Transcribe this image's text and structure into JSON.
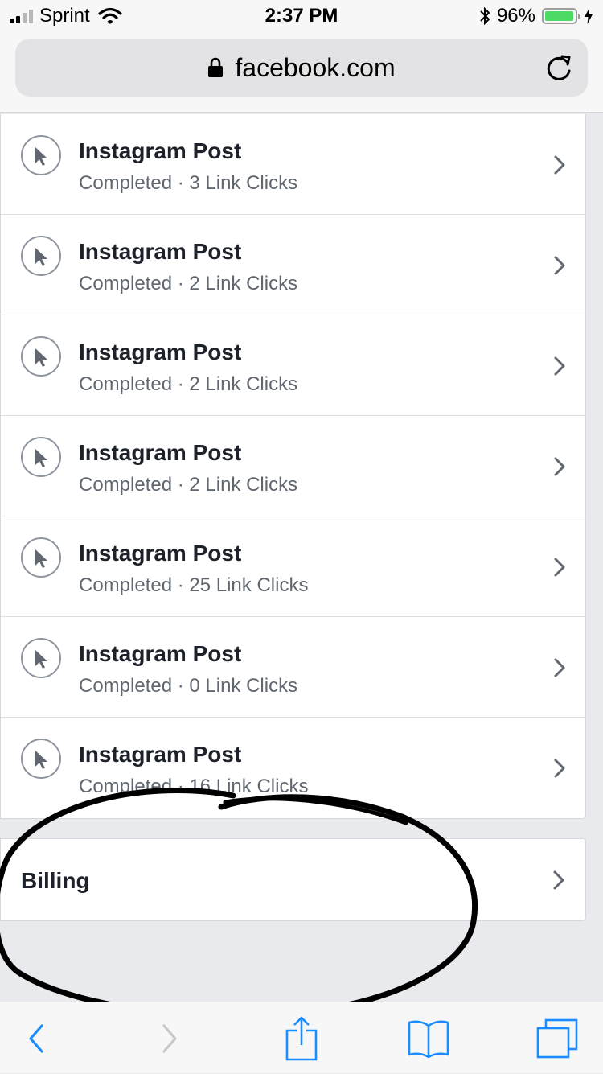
{
  "status_bar": {
    "carrier": "Sprint",
    "time": "2:37 PM",
    "battery_percent": "96%",
    "battery_level": 0.96,
    "icons": [
      "signal-icon",
      "wifi-icon",
      "bluetooth-icon",
      "battery-icon",
      "charging-icon"
    ]
  },
  "address_bar": {
    "url": "facebook.com",
    "icons": [
      "lock-icon",
      "reload-icon"
    ]
  },
  "campaigns": [
    {
      "title": "Instagram Post",
      "subtitle": "Completed · 3 Link Clicks"
    },
    {
      "title": "Instagram Post",
      "subtitle": "Completed · 2 Link Clicks"
    },
    {
      "title": "Instagram Post",
      "subtitle": "Completed · 2 Link Clicks"
    },
    {
      "title": "Instagram Post",
      "subtitle": "Completed · 2 Link Clicks"
    },
    {
      "title": "Instagram Post",
      "subtitle": "Completed · 25 Link Clicks"
    },
    {
      "title": "Instagram Post",
      "subtitle": "Completed · 0 Link Clicks"
    },
    {
      "title": "Instagram Post",
      "subtitle": "Completed · 16 Link Clicks"
    }
  ],
  "billing": {
    "label": "Billing"
  },
  "toolbar": {
    "icons": [
      "back-icon",
      "forward-icon",
      "share-icon",
      "bookmarks-icon",
      "tabs-icon"
    ]
  },
  "colors": {
    "accent": "#1a8cff",
    "battery_fill": "#4cd964",
    "background": "#e9eaed",
    "annotation_ink": "#000000"
  }
}
